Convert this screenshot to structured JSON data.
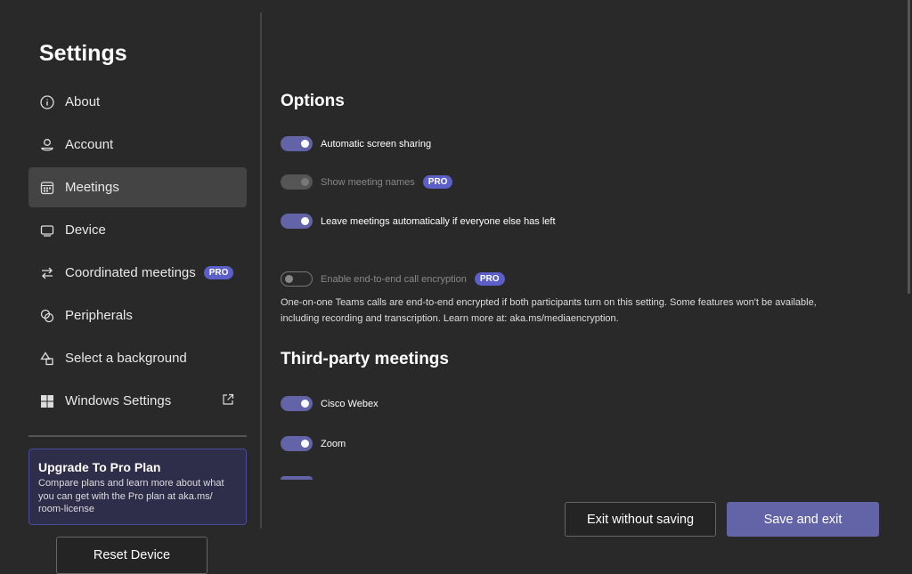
{
  "sidebar": {
    "title": "Settings",
    "items": [
      {
        "label": "About",
        "icon": "info-icon"
      },
      {
        "label": "Account",
        "icon": "person-icon"
      },
      {
        "label": "Meetings",
        "icon": "calendar-icon",
        "selected": true
      },
      {
        "label": "Device",
        "icon": "monitor-icon"
      },
      {
        "label": "Coordinated meetings",
        "icon": "arrows-swap-icon",
        "badge": "PRO"
      },
      {
        "label": "Peripherals",
        "icon": "peripherals-icon"
      },
      {
        "label": "Select a background",
        "icon": "shapes-icon"
      },
      {
        "label": "Windows Settings",
        "icon": "windows-icon",
        "external": "external-link-icon"
      }
    ],
    "upgrade": {
      "title": "Upgrade To Pro Plan",
      "text": "Compare plans and learn more about what you can get with the Pro plan at aka.ms/ room-license"
    },
    "reset_label": "Reset Device"
  },
  "main": {
    "options_title": "Options",
    "options": [
      {
        "label": "Automatic screen sharing",
        "state": "on"
      },
      {
        "label": "Show meeting names",
        "state": "disabled",
        "badge": "PRO"
      },
      {
        "label": "Leave meetings automatically if everyone else has left",
        "state": "on"
      },
      {
        "label": "Enable end-to-end call encryption",
        "state": "off",
        "badge": "PRO"
      }
    ],
    "encryption_desc": "One-on-one Teams calls are end-to-end encrypted if both participants turn on this setting. Some features won't be available, including recording and transcription. Learn more at: aka.ms/mediaencryption.",
    "third_party_title": "Third-party meetings",
    "third_party": [
      {
        "label": "Cisco Webex",
        "state": "on"
      },
      {
        "label": "Zoom",
        "state": "on"
      }
    ]
  },
  "footer": {
    "exit_label": "Exit without saving",
    "save_label": "Save and exit"
  },
  "colors": {
    "accent": "#6264a7",
    "background": "#292929"
  }
}
